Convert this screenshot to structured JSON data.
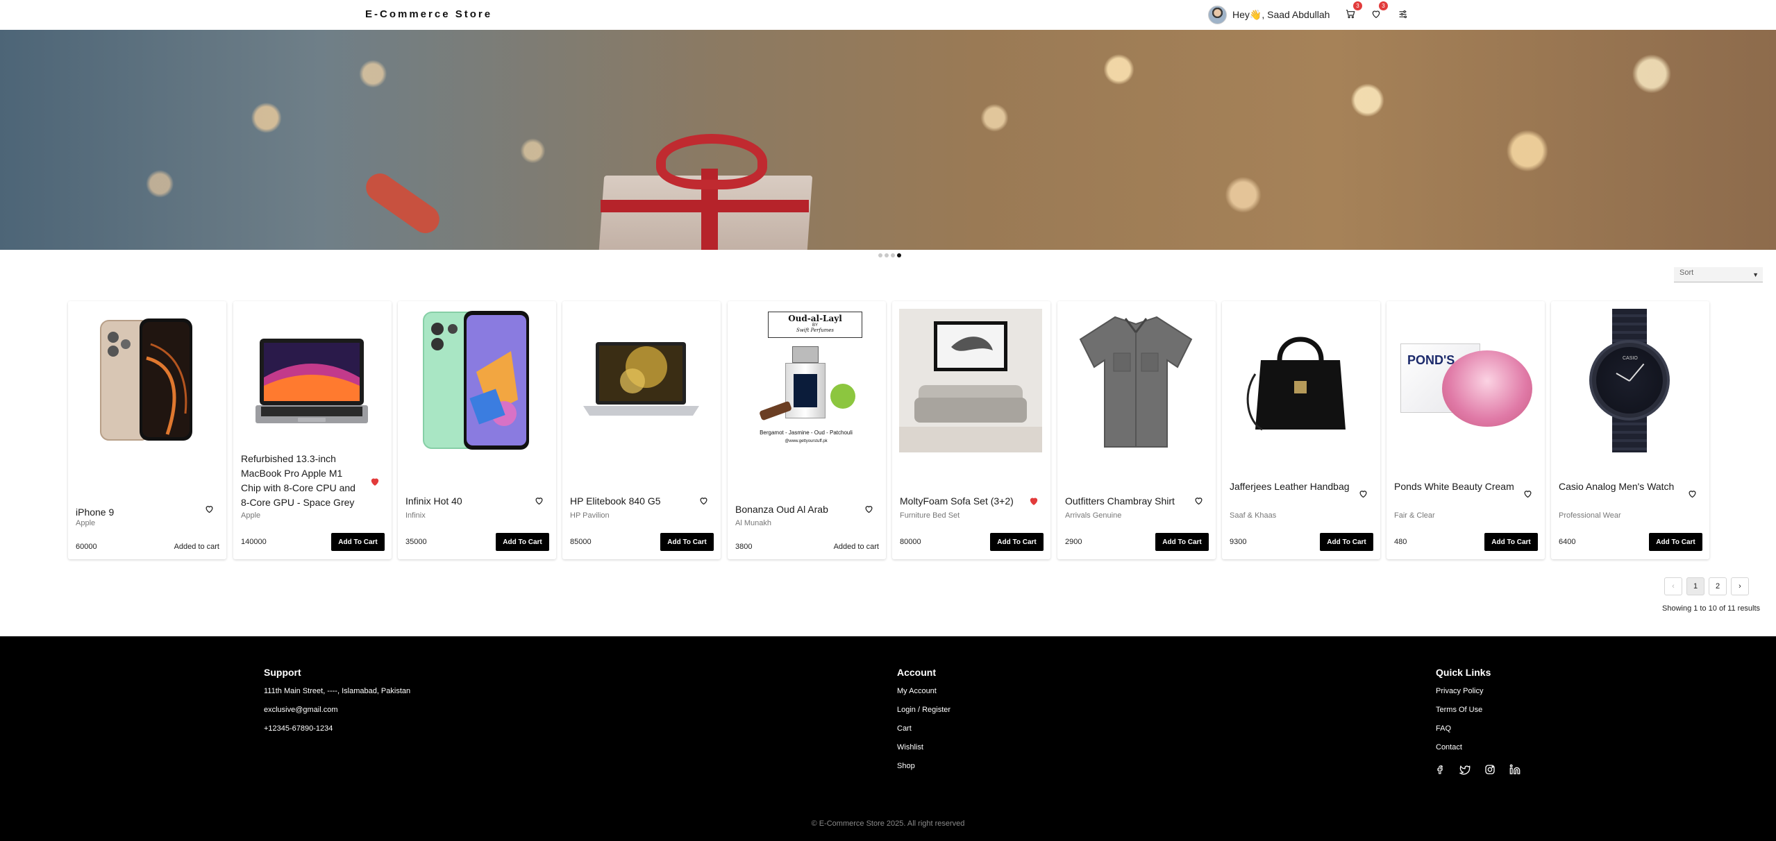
{
  "header": {
    "brand": "E-Commerce Store",
    "greeting": "Hey👋, Saad Abdullah",
    "cart_count": "3",
    "wishlist_count": "3"
  },
  "carousel": {
    "slides": 4,
    "active": 4
  },
  "sort": {
    "label": "Sort"
  },
  "products": [
    {
      "name": "iPhone 9",
      "brand": "Apple",
      "price": "60000",
      "status": "Added to cart",
      "in_cart": true,
      "wished": false
    },
    {
      "name": "Refurbished 13.3-inch MacBook Pro Apple M1 Chip with 8-Core CPU and 8-Core GPU - Space Grey",
      "brand": "Apple",
      "price": "140000",
      "button": "Add To Cart",
      "in_cart": false,
      "wished": true
    },
    {
      "name": "Infinix Hot 40",
      "brand": "Infinix",
      "price": "35000",
      "button": "Add To Cart",
      "in_cart": false,
      "wished": false
    },
    {
      "name": "HP Elitebook 840 G5",
      "brand": "HP Pavilion",
      "price": "85000",
      "button": "Add To Cart",
      "in_cart": false,
      "wished": false
    },
    {
      "name": "Bonanza Oud Al Arab",
      "brand": "Al Munakh",
      "price": "3800",
      "status": "Added to cart",
      "in_cart": true,
      "wished": false,
      "image_text": {
        "title": "Oud-al-Layl",
        "by": "BY",
        "maker": "Swift Perfumes",
        "notes": "Bergamot - Jasmine - Oud - Patchouli",
        "site": "@www.gettyourstuff.pk"
      }
    },
    {
      "name": "MoltyFoam Sofa Set (3+2)",
      "brand": "Furniture Bed Set",
      "price": "80000",
      "button": "Add To Cart",
      "in_cart": false,
      "wished": true
    },
    {
      "name": "Outfitters Chambray Shirt",
      "brand": "Arrivals Genuine",
      "price": "2900",
      "button": "Add To Cart",
      "in_cart": false,
      "wished": false
    },
    {
      "name": "Jafferjees Leather Handbag",
      "brand": "Saaf & Khaas",
      "price": "9300",
      "button": "Add To Cart",
      "in_cart": false,
      "wished": false
    },
    {
      "name": "Ponds White Beauty Cream",
      "brand": "Fair & Clear",
      "price": "480",
      "button": "Add To Cart",
      "in_cart": false,
      "wished": false,
      "image_text": {
        "label": "POND'S"
      }
    },
    {
      "name": "Casio Analog Men's Watch",
      "brand": "Professional Wear",
      "price": "6400",
      "button": "Add To Cart",
      "in_cart": false,
      "wished": false,
      "image_text": {
        "label": "CASIO"
      }
    }
  ],
  "pagination": {
    "pages": [
      "1",
      "2"
    ],
    "current": "1",
    "prev": "‹",
    "next": "›",
    "summary": "Showing 1 to 10 of 11 results"
  },
  "footer": {
    "support": {
      "title": "Support",
      "address": "111th Main Street, ----, Islamabad, Pakistan",
      "email": "exclusive@gmail.com",
      "phone": "+12345-67890-1234"
    },
    "account": {
      "title": "Account",
      "links": [
        "My Account",
        "Login / Register",
        "Cart",
        "Wishlist",
        "Shop"
      ]
    },
    "quick": {
      "title": "Quick Links",
      "links": [
        "Privacy Policy",
        "Terms Of Use",
        "FAQ",
        "Contact"
      ]
    },
    "social_icons": [
      "facebook-icon",
      "twitter-icon",
      "instagram-icon",
      "linkedin-icon"
    ],
    "copyright": "© E-Commerce Store 2025. All right reserved"
  },
  "colors": {
    "accent": "#000000",
    "heart_active": "#e23b3b",
    "footer_bg": "#000000"
  }
}
